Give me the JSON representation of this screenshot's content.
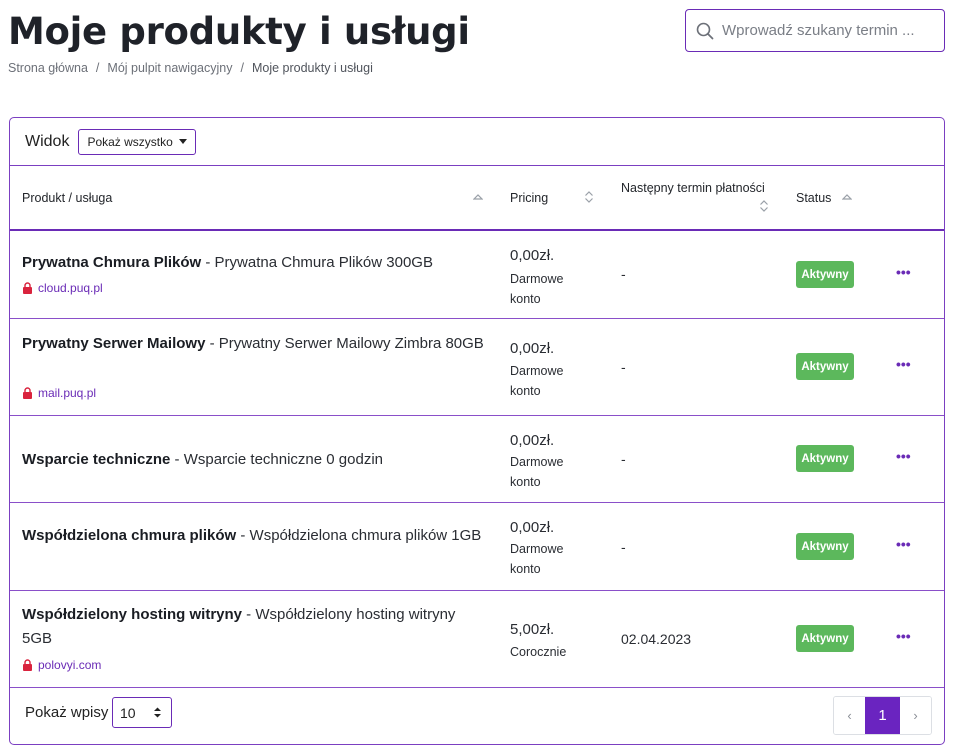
{
  "header": {
    "title": "Moje produkty i usługi",
    "breadcrumb": [
      "Strona główna",
      "Mój pulpit nawigacyjny",
      "Moje produkty i usługi"
    ],
    "search_placeholder": "Wprowadź szukany termin ..."
  },
  "toolbar": {
    "view_label": "Widok",
    "view_selected": "Pokaż wszystko"
  },
  "table": {
    "columns": {
      "product": "Produkt / usługa",
      "pricing": "Pricing",
      "due": "Następny termin płatności",
      "status": "Status"
    },
    "rows": [
      {
        "name": "Prywatna Chmura Plików",
        "desc": " - Prywatna Chmura Plików 300GB",
        "domain": "cloud.puq.pl",
        "price": "0,00zł.",
        "cycle": "Darmowe konto",
        "due": "-",
        "status": "Aktywny"
      },
      {
        "name": "Prywatny Serwer Mailowy",
        "desc": " - Prywatny Serwer Mailowy Zimbra 80GB",
        "domain": "mail.puq.pl",
        "price": "0,00zł.",
        "cycle": "Darmowe konto",
        "due": "-",
        "status": "Aktywny"
      },
      {
        "name": "Wsparcie techniczne",
        "desc": " - Wsparcie techniczne 0 godzin",
        "domain": "",
        "price": "0,00zł.",
        "cycle": "Darmowe konto",
        "due": "-",
        "status": "Aktywny"
      },
      {
        "name": "Współdzielona chmura plików",
        "desc": " - Współdzielona chmura plików 1GB",
        "domain": "",
        "price": "0,00zł.",
        "cycle": "Darmowe konto",
        "due": "-",
        "status": "Aktywny"
      },
      {
        "name": "Współdzielony hosting witryny",
        "desc": " - Współdzielony hosting witryny 5GB",
        "domain": "polovyi.com",
        "price": "5,00zł.",
        "cycle": "Corocznie",
        "due": "02.04.2023",
        "status": "Aktywny"
      }
    ],
    "more_icon": "ellipsis-icon",
    "lock_icon": "lock-icon"
  },
  "footer": {
    "entries_label": "Pokaż wpisy",
    "entries_value": "10",
    "pagination": {
      "prev": "‹",
      "current": "1",
      "next": "›"
    }
  },
  "colors": {
    "accent": "#6a24c0",
    "status_active": "#5cb85c",
    "lock": "#d9233d"
  }
}
